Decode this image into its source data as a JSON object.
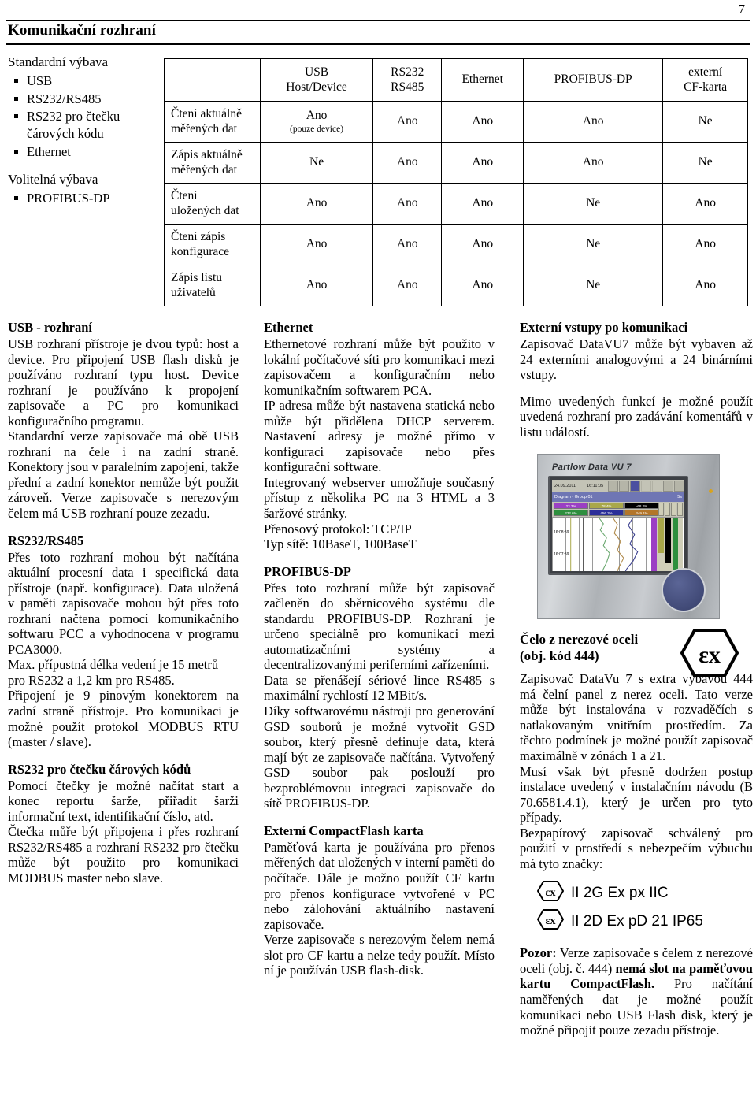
{
  "page": {
    "number": "7",
    "title": "Komunikační rozhraní"
  },
  "features": {
    "standard_heading": "Standardní výbava",
    "standard_items": [
      {
        "label": "USB"
      },
      {
        "label": "RS232/RS485"
      },
      {
        "label": "RS232 pro čtečku",
        "cont": "čárových kódu"
      },
      {
        "label": "Ethernet"
      }
    ],
    "optional_heading": "Volitelná výbava",
    "optional_items": [
      {
        "label": "PROFIBUS-DP"
      }
    ]
  },
  "table": {
    "columns": [
      {
        "line1": "USB",
        "line2": "Host/Device"
      },
      {
        "line1": "RS232",
        "line2": "RS485"
      },
      {
        "line1": "Ethernet",
        "line2": ""
      },
      {
        "line1": "PROFIBUS-DP",
        "line2": ""
      },
      {
        "line1": "externí",
        "line2": "CF-karta"
      }
    ],
    "rows": [
      {
        "label_line1": "Čtení aktuálně",
        "label_line2": "měřených dat",
        "cells": [
          "Ano",
          "Ano",
          "Ano",
          "Ano",
          "Ne"
        ],
        "cell_notes": [
          "(pouze device)",
          "",
          "",
          "",
          ""
        ]
      },
      {
        "label_line1": "Zápis aktuálně",
        "label_line2": "měřených dat",
        "cells": [
          "Ne",
          "Ano",
          "Ano",
          "Ano",
          "Ne"
        ],
        "cell_notes": [
          "",
          "",
          "",
          "",
          ""
        ]
      },
      {
        "label_line1": "Čtení",
        "label_line2": "uložených dat",
        "cells": [
          "Ano",
          "Ano",
          "Ano",
          "Ne",
          "Ano"
        ],
        "cell_notes": [
          "",
          "",
          "",
          "",
          ""
        ]
      },
      {
        "label_line1": "Čtení zápis",
        "label_line2": "konfigurace",
        "cells": [
          "Ano",
          "Ano",
          "Ano",
          "Ne",
          "Ano"
        ],
        "cell_notes": [
          "",
          "",
          "",
          "",
          ""
        ]
      },
      {
        "label_line1": "Zápis listu",
        "label_line2": "uživatelů",
        "cells": [
          "Ano",
          "Ano",
          "Ano",
          "Ne",
          "Ano"
        ],
        "cell_notes": [
          "",
          "",
          "",
          "",
          ""
        ]
      }
    ]
  },
  "col1": {
    "usb_heading": "USB - rozhraní",
    "usb_p1": "USB rozhraní přístroje je dvou typů: host a device. Pro připojení USB flash disků je používáno rozhraní typu host. Device rozhraní je používáno k propojení zapisovače a PC pro komunikaci konfiguračního programu.",
    "usb_p2": "Standardní verze zapisovače má obě USB rozhraní na čele i na zadní straně. Konektory jsou v paralelním zapojení, takže přední a zadní konektor nemůže být použit zároveň. Verze zapisovače s nerezovým čelem má USB rozhraní pouze zezadu.",
    "rs_heading": "RS232/RS485",
    "rs_p1": "Přes toto rozhraní mohou být načítána aktuální procesní data i specifická data přístroje (např. konfigurace). Data uložená v paměti zapisovače mohou být přes toto rozhraní načtena pomocí komunikačního softwaru PCC a vyhodnocena v programu PCA3000.",
    "rs_p2": "Max. přípustná délka vedení je 15 metrů pro RS232 a 1,2 km pro RS485.",
    "rs_p3": "Připojení je 9 pinovým konektorem na zadní straně přístroje. Pro komunikaci je možné použít protokol MODBUS RTU (master / slave).",
    "bar_heading": "RS232 pro čtečku čárových kódů",
    "bar_p1": "Pomocí čtečky je možné načítat start a konec reportu šarže, přiřadit šarži informační text, identifikační číslo, atd.",
    "bar_p2": "Čtečka můře být připojena i přes rozhraní RS232/RS485 a rozhraní RS232 pro čtečku může být použito pro komunikaci MODBUS master nebo slave."
  },
  "col2": {
    "eth_heading": "Ethernet",
    "eth_p1": "Ethernetové rozhraní může být použito v lokální počítačové síti pro komunikaci mezi zapisovačem a konfiguračním nebo komunikačním softwarem PCA.",
    "eth_p2": "IP adresa může být nastavena statická nebo může být přidělena DHCP serverem. Nastavení adresy je možné přímo v konfiguraci zapisovače nebo přes konfigurační software.",
    "eth_p3": "Integrovaný webserver umožňuje současný přístup z několika PC na 3 HTML a 3 šaržové stránky.",
    "eth_p4": "Přenosový protokol: TCP/IP",
    "eth_p5": "Typ sítě: 10BaseT, 100BaseT",
    "pb_heading": "PROFIBUS-DP",
    "pb_p1": "Přes toto rozhraní může být zapisovač začleněn do sběrnicového systému dle standardu PROFIBUS-DP. Rozhraní je určeno speciálně pro komunikaci mezi automatizačními systémy a decentralizovanými periferními zařízeními.",
    "pb_p2": "Data se přenášejí sériové lince RS485 s maximální rychlostí 12 MBit/s.",
    "pb_p3": "Díky softwarovému nástroji pro generování GSD souborů je možné vytvořit GSD soubor, který přesně definuje data, která mají být ze zapisovače načítána. Vytvořený GSD soubor pak poslouží pro bezproblémovou integraci zapisovače do sítě PROFIBUS-DP.",
    "cf_heading": "Externí CompactFlash karta",
    "cf_p1": "Paměťová karta je používána pro přenos měřených dat uložených v interní paměti do počítače. Dále je možno použít CF kartu pro přenos konfigurace vytvořené v PC nebo zálohování aktuálního nastavení zapisovače.",
    "cf_p2": "Verze zapisovače s nerezovým čelem nemá slot pro CF kartu a nelze tedy použít. Místo ní je používán USB flash-disk."
  },
  "col3": {
    "ext_heading": "Externí vstupy po komunikaci",
    "ext_p1": "Zapisovač DataVU7 může být vybaven až 24 externími analogovými a 24 binárními vstupy.",
    "ext_p2": "Mimo uvedených funkcí je možné použít uvedená rozhraní pro zadávání komentářů v listu událostí.",
    "device": {
      "brand": "Partlow Data VU 7",
      "screen": {
        "date": "24.09.2011",
        "time": "16:11:05",
        "zoom_label": "100%",
        "diagram_title": "Diagram - Group 01",
        "interval": "5s",
        "badges": [
          "23.3%",
          "78.4%",
          "-68.2%",
          "232.6%",
          "456.3%",
          "349.1%"
        ],
        "time_labels": [
          "16:08:59",
          "16:07:59"
        ]
      }
    },
    "stainless_heading_line1": "Čelo z nerezové oceli",
    "stainless_heading_line2": "(obj. kód 444)",
    "stainless_p1": "Zapisovač DataVu 7 s extra výbavou 444 má čelní panel z nerez oceli. Tato verze může být instalována v rozvaděčích s natlakovaným vnitřním prostředím. Za těchto podmínek je možné použít zapisovač maximálně v zónách 1 a 21.",
    "stainless_p2": "Musí však být přesně dodržen postup instalace uvedený v instalačním návodu (B 70.6581.4.1), který je určen pro tyto případy.",
    "stainless_p3": "Bezpapírový zapisovač schválený pro použití v prostředí s nebezpečím výbuchu má tyto značky:",
    "marks": [
      {
        "icon": "ex-hexagon-icon",
        "text": "II 2G Ex px IIC"
      },
      {
        "icon": "ex-hexagon-icon",
        "text": "II 2D Ex pD 21 IP65"
      }
    ],
    "warning_label": "Pozor:",
    "warning_t1": " Verze zapisovače s čelem z nerezové oceli (obj. č. 444) ",
    "warning_b1": "nemá slot na paměťovou kartu CompactFlash.",
    "warning_t2": " Pro načítání naměřených dat je možné použít komunikaci nebo USB Flash disk, který je možné připojit pouze zezadu přístroje."
  }
}
